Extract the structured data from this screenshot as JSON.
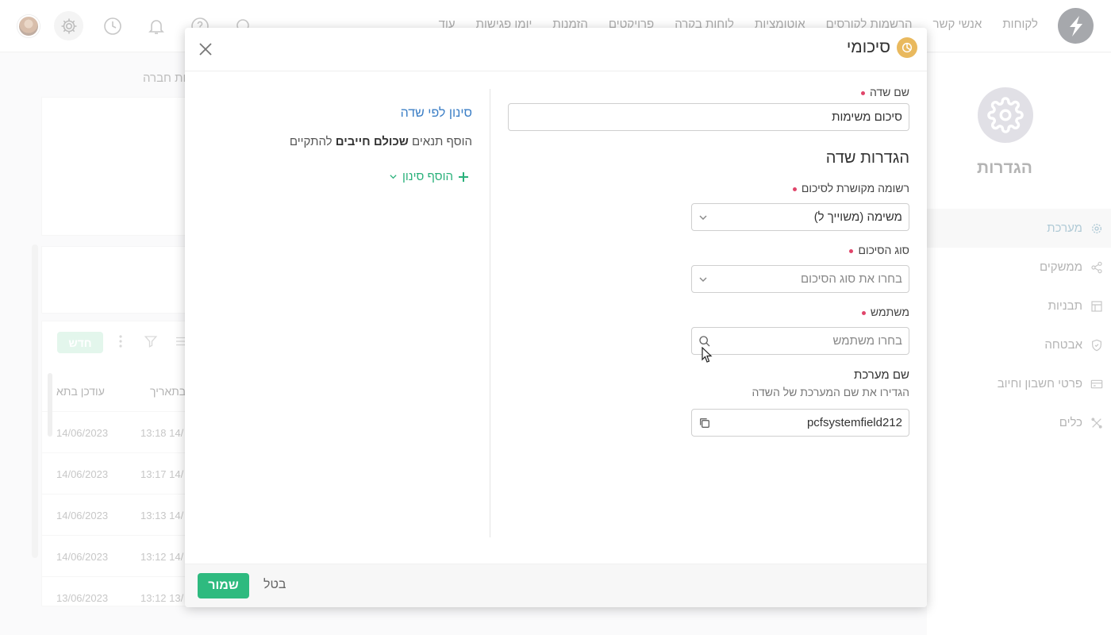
{
  "topbar": {
    "nav_items": [
      "לקוחות",
      "אנשי קשר",
      "הרשמות לקורסים",
      "אוטומציות",
      "לוחות בקרה",
      "פרויקטים",
      "הזמנות",
      "יומן פגישות",
      "עוד"
    ]
  },
  "settings": {
    "title": "הגדרות",
    "items": [
      {
        "label": "מערכת",
        "icon": "gear-icon",
        "active": true
      },
      {
        "label": "ממשקים",
        "icon": "share-icon"
      },
      {
        "label": "תבניות",
        "icon": "layout-icon"
      },
      {
        "label": "אבטחה",
        "icon": "shield-icon"
      },
      {
        "label": "פרטי חשבון וחיוב",
        "icon": "card-icon"
      },
      {
        "label": "כלים",
        "icon": "tools-icon"
      }
    ]
  },
  "background": {
    "heading": "שדות חברה",
    "new_button": "חדש",
    "columns": [
      "עודכן בתא",
      "בתאריך"
    ],
    "rows": [
      {
        "updated": "14/06/2023",
        "time": "13:18 14/"
      },
      {
        "updated": "14/06/2023",
        "time": "13:17 14/"
      },
      {
        "updated": "14/06/2023",
        "time": "13:13 14/"
      },
      {
        "updated": "14/06/2023",
        "time": "13:12 14/"
      },
      {
        "updated": "13/06/2023",
        "time": "13:12 13/"
      }
    ]
  },
  "modal": {
    "title": "סיכומי",
    "field_name_label": "שם שדה",
    "field_name_value": "סיכום משימות",
    "section_title": "הגדרות שדה",
    "related_list_label": "רשומה מקושרת לסיכום",
    "related_list_value": "משימה (משוייך ל)",
    "summary_type_label": "סוג הסיכום",
    "summary_type_placeholder": "בחרו את סוג הסיכום",
    "user_label": "משתמש",
    "user_placeholder": "בחרו משתמש",
    "system_name_label": "שם מערכת",
    "system_name_help": "הגדירו את שם המערכת של השדה",
    "system_name_value": "pcfsystemfield212",
    "filter_title": "סינון לפי שדה",
    "filter_desc_pre": "הוסף תנאים",
    "filter_desc_bold": "שכולם חייבים",
    "filter_desc_post": "להתקיים",
    "add_filter": "הוסף סינון",
    "save": "שמור",
    "cancel": "בטל"
  },
  "colors": {
    "accent_green": "#2eba7f",
    "link_blue": "#3c7fc6",
    "required_dot": "#e0456a",
    "title_icon": "#e9b95e"
  }
}
